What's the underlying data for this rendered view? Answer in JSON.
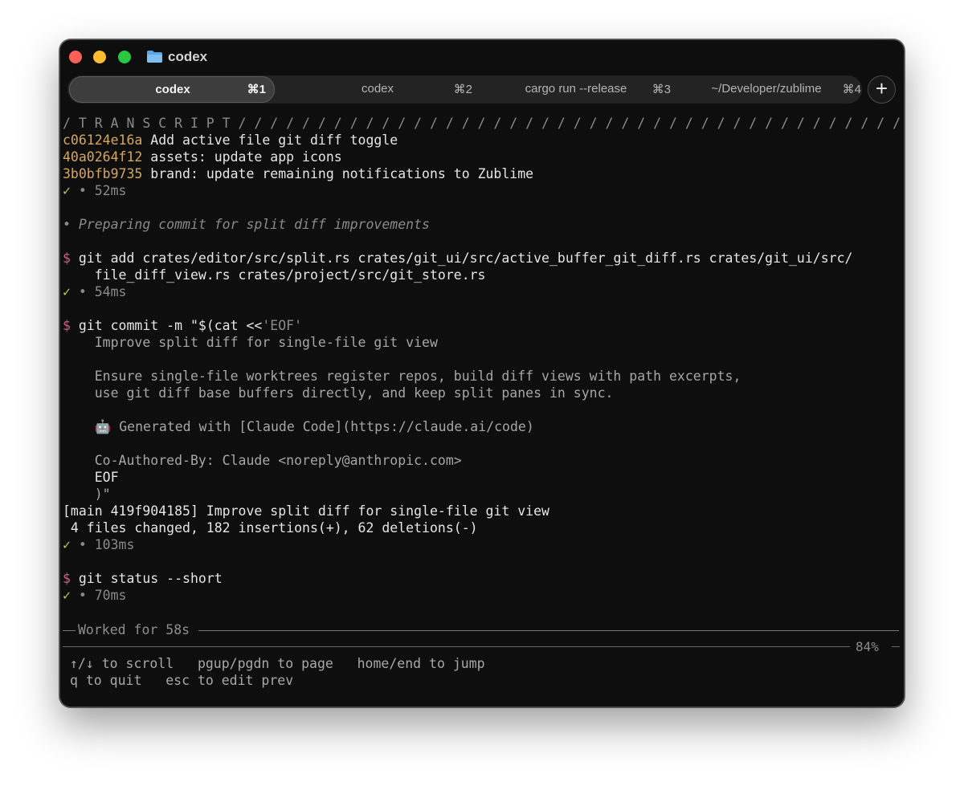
{
  "window": {
    "title": "codex",
    "folder_icon": "folder-icon"
  },
  "tabs": [
    {
      "label": "codex",
      "shortcut": "⌘1",
      "active": true
    },
    {
      "label": "codex",
      "shortcut": "⌘2",
      "active": false
    },
    {
      "label": "cargo run --release",
      "shortcut": "⌘3",
      "active": false
    },
    {
      "label": "~/Developer/zublime",
      "shortcut": "⌘4",
      "active": false
    }
  ],
  "add_tab_label": "+",
  "transcript": {
    "header": "/ T R A N S C R I P T / / / / / / / / / / / / / / / / / / / / / / / / / / / / / / / / / / / / / / / / / /",
    "commits": [
      {
        "hash": "c06124e16a",
        "message": " Add active file git diff toggle"
      },
      {
        "hash": "40a0264f12",
        "message": " assets: update app icons"
      },
      {
        "hash": "3b0bfb9735",
        "message": " brand: update remaining notifications to Zublime"
      }
    ],
    "timing_1": " • 52ms",
    "status_note": "• Preparing commit for split diff improvements",
    "cmd_add_line1": " git add crates/editor/src/split.rs crates/git_ui/src/active_buffer_git_diff.rs crates/git_ui/src/",
    "cmd_add_line2": "    file_diff_view.rs crates/project/src/git_store.rs",
    "timing_2": " • 54ms",
    "cmd_commit": " git commit -m \"$(cat <<",
    "cmd_commit_eof": "'EOF'",
    "heredoc": [
      "    Improve split diff for single-file git view",
      "",
      "    Ensure single-file worktrees register repos, build diff views with path excerpts,",
      "    use git diff base buffers directly, and keep split panes in sync.",
      "",
      "    🤖 Generated with [Claude Code](https://claude.ai/code)",
      "",
      "    Co-Authored-By: Claude <noreply@anthropic.com>"
    ],
    "heredoc_eof": "    EOF",
    "heredoc_close": "    )\"",
    "commit_result": "[main 419f904185] Improve split diff for single-file git view",
    "commit_stats": " 4 files changed, 182 insertions(+), 62 deletions(-)",
    "timing_3": " • 103ms",
    "cmd_status": " git status --short",
    "timing_4": " • 70ms",
    "prompt_symbol": "$",
    "ok_symbol": "✓"
  },
  "worked_label": "Worked for 58s",
  "scroll_percent": "84%",
  "help": {
    "line1": "↑/↓ to scroll   pgup/pgdn to page   home/end to jump",
    "line2": "q to quit   esc to edit prev"
  }
}
